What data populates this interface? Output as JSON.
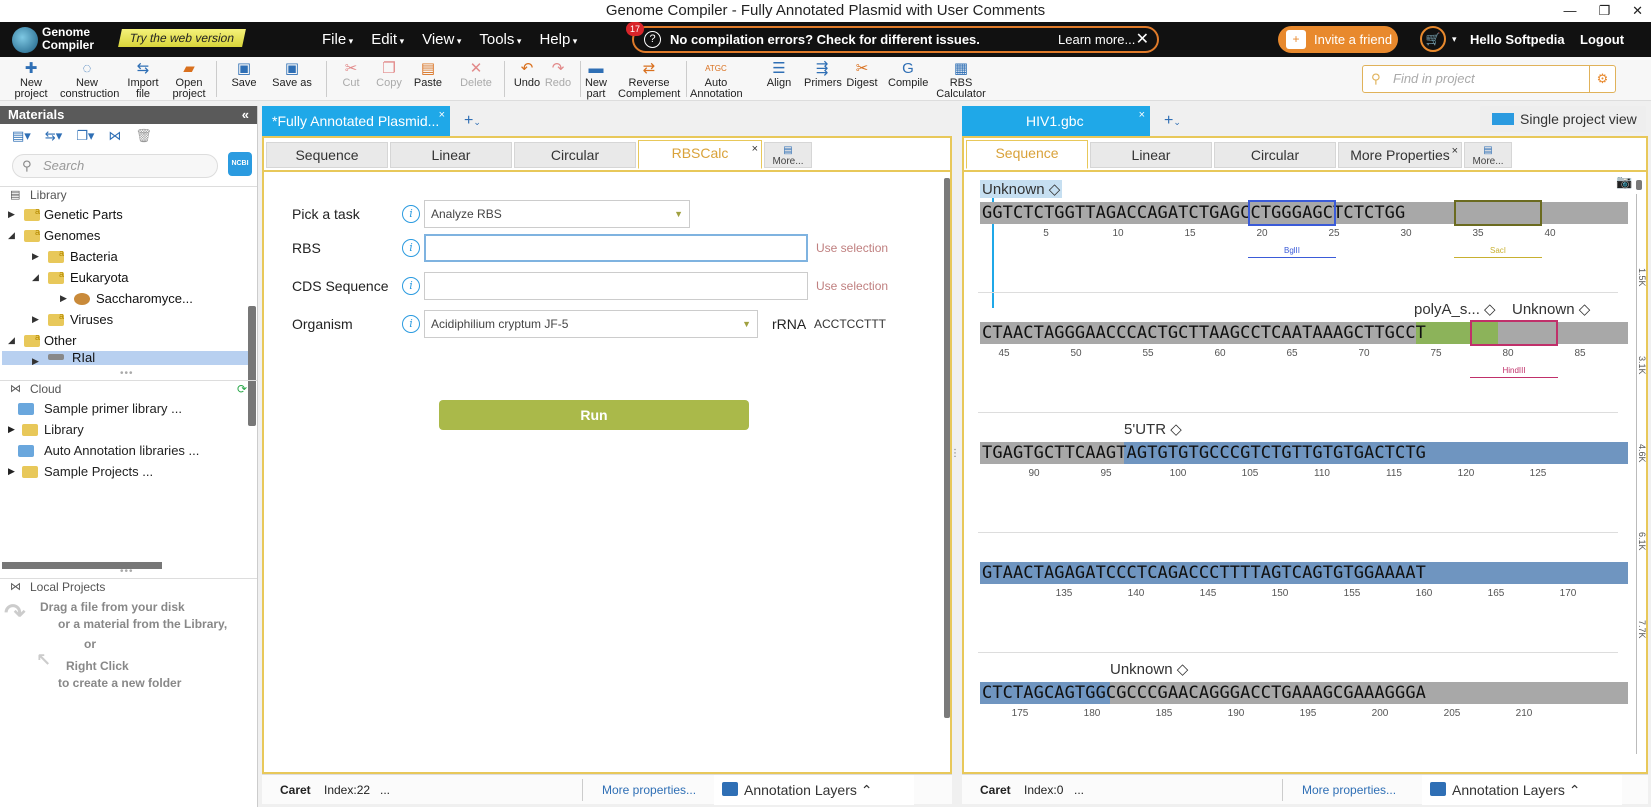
{
  "window": {
    "title": "Genome Compiler - Fully Annotated Plasmid with User Comments"
  },
  "header": {
    "logo_line1": "Genome",
    "logo_line2": "Compiler",
    "try_web": "Try the web version",
    "menu": [
      "File",
      "Edit",
      "View",
      "Tools",
      "Help"
    ],
    "notice_badge": "17",
    "notice_message": "No compilation errors? Check for different issues.",
    "notice_link": "Learn more...",
    "invite": "Invite a friend",
    "greeting": "Hello Softpedia",
    "logout": "Logout"
  },
  "toolbar": {
    "new_project": [
      "New",
      "project"
    ],
    "new_construction": [
      "New",
      "construction"
    ],
    "import_file": [
      "Import",
      "file"
    ],
    "open_project": [
      "Open",
      "project"
    ],
    "save": "Save",
    "save_as": "Save as",
    "cut": "Cut",
    "copy": "Copy",
    "paste": "Paste",
    "delete": "Delete",
    "undo": "Undo",
    "redo": "Redo",
    "new_part": [
      "New",
      "part"
    ],
    "reverse_complement": [
      "Reverse",
      "Complement"
    ],
    "auto_annotation_icon": "ATGC",
    "auto_annotation": [
      "Auto",
      "Annotation"
    ],
    "align": "Align",
    "primers": "Primers",
    "digest": "Digest",
    "compile": "Compile",
    "rbs_calculator": [
      "RBS",
      "Calculator"
    ],
    "find_placeholder": "Find in project"
  },
  "materials": {
    "title": "Materials",
    "search_placeholder": "Search",
    "ncbi": "NCBI",
    "library_section": "Library",
    "tree": [
      {
        "label": "Genetic Parts",
        "depth": 0,
        "expanded": false
      },
      {
        "label": "Genomes",
        "depth": 0,
        "expanded": true
      },
      {
        "label": "Bacteria",
        "depth": 1,
        "expanded": false
      },
      {
        "label": "Eukaryota",
        "depth": 1,
        "expanded": true
      },
      {
        "label": "Saccharomyce...",
        "depth": 2,
        "expanded": false
      },
      {
        "label": "Viruses",
        "depth": 1,
        "expanded": false
      },
      {
        "label": "Other",
        "depth": 0,
        "expanded": true
      },
      {
        "label": "RIal",
        "depth": 1,
        "expanded": false
      }
    ],
    "cloud_section": "Cloud",
    "cloud_items": [
      "Sample primer library ...",
      "Library",
      "Auto Annotation libraries ...",
      "Sample Projects ..."
    ],
    "local_section": "Local Projects",
    "hint_lines": [
      "Drag a file from your disk",
      "or a material from the Library,",
      "or",
      "Right Click",
      "to create a new folder"
    ]
  },
  "left_pane": {
    "doc_tab": "*Fully Annotated Plasmid...",
    "view_tabs": [
      "Sequence",
      "Linear",
      "Circular",
      "RBSCalc"
    ],
    "active_tab": "RBSCalc",
    "more_tab": "More...",
    "form": {
      "task_label": "Pick a task",
      "task_value": "Analyze RBS",
      "rbs_label": "RBS",
      "rbs_value": "",
      "cds_label": "CDS Sequence",
      "cds_value": "",
      "use_selection": "Use selection",
      "organism_label": "Organism",
      "organism_value": "Acidiphilium cryptum JF-5",
      "rrna_label": "rRNA",
      "rrna_value": "ACCTCCTTT",
      "run": "Run"
    },
    "status": {
      "caret": "Caret",
      "index": "Index:22",
      "dots": "...",
      "more": "More properties...",
      "layers": "Annotation Layers"
    }
  },
  "right_pane": {
    "doc_tab": "HIV1.gbc",
    "single_view": "Single project view",
    "view_tabs": [
      "Sequence",
      "Linear",
      "Circular",
      "More Properties"
    ],
    "active_tab": "Sequence",
    "more_tab": "More...",
    "rows": [
      {
        "labels": [
          "Unknown ◇"
        ],
        "seq": "GGTCTCTGGTTAGACCAGATCTGAGCCTGGGAGCTCTCTGG",
        "ticks": [
          "5",
          "10",
          "15",
          "20",
          "25",
          "30",
          "35",
          "40"
        ],
        "enzymes": [
          "BglII",
          "SacI"
        ]
      },
      {
        "labels": [
          "polyA_s... ◇",
          "Unknown ◇"
        ],
        "seq": "CTAACTAGGGAACCCACTGCTTAAGCCTCAATAAAGCTTGCCT",
        "ticks": [
          "45",
          "50",
          "55",
          "60",
          "65",
          "70",
          "75",
          "80",
          "85"
        ],
        "enzymes": [
          "HindIII"
        ]
      },
      {
        "labels": [
          "5'UTR ◇"
        ],
        "seq": "TGAGTGCTTCAAGTAGTGTGTGCCCGTCTGTTGTGTGACTCTG",
        "ticks": [
          "90",
          "95",
          "100",
          "105",
          "110",
          "115",
          "120",
          "125"
        ],
        "enzymes": []
      },
      {
        "labels": [],
        "seq": "GTAACTAGAGATCCCTCAGACCCTTTTAGTCAGTGTGGAAAAT",
        "ticks": [
          "135",
          "140",
          "145",
          "150",
          "155",
          "160",
          "165",
          "170"
        ],
        "enzymes": []
      },
      {
        "labels": [
          "Unknown ◇"
        ],
        "seq": "CTCTAGCAGTGGCGCCCGAACAGGGACCTGAAAGCGAAAGGGA",
        "ticks": [
          "175",
          "180",
          "185",
          "190",
          "195",
          "200",
          "205",
          "210"
        ],
        "enzymes": []
      }
    ],
    "ruler": [
      "1.5K",
      "3.1K",
      "4.6K",
      "6.1K",
      "7.7K"
    ],
    "status": {
      "caret": "Caret",
      "index": "Index:0",
      "dots": "...",
      "more": "More properties...",
      "layers": "Annotation Layers"
    }
  }
}
